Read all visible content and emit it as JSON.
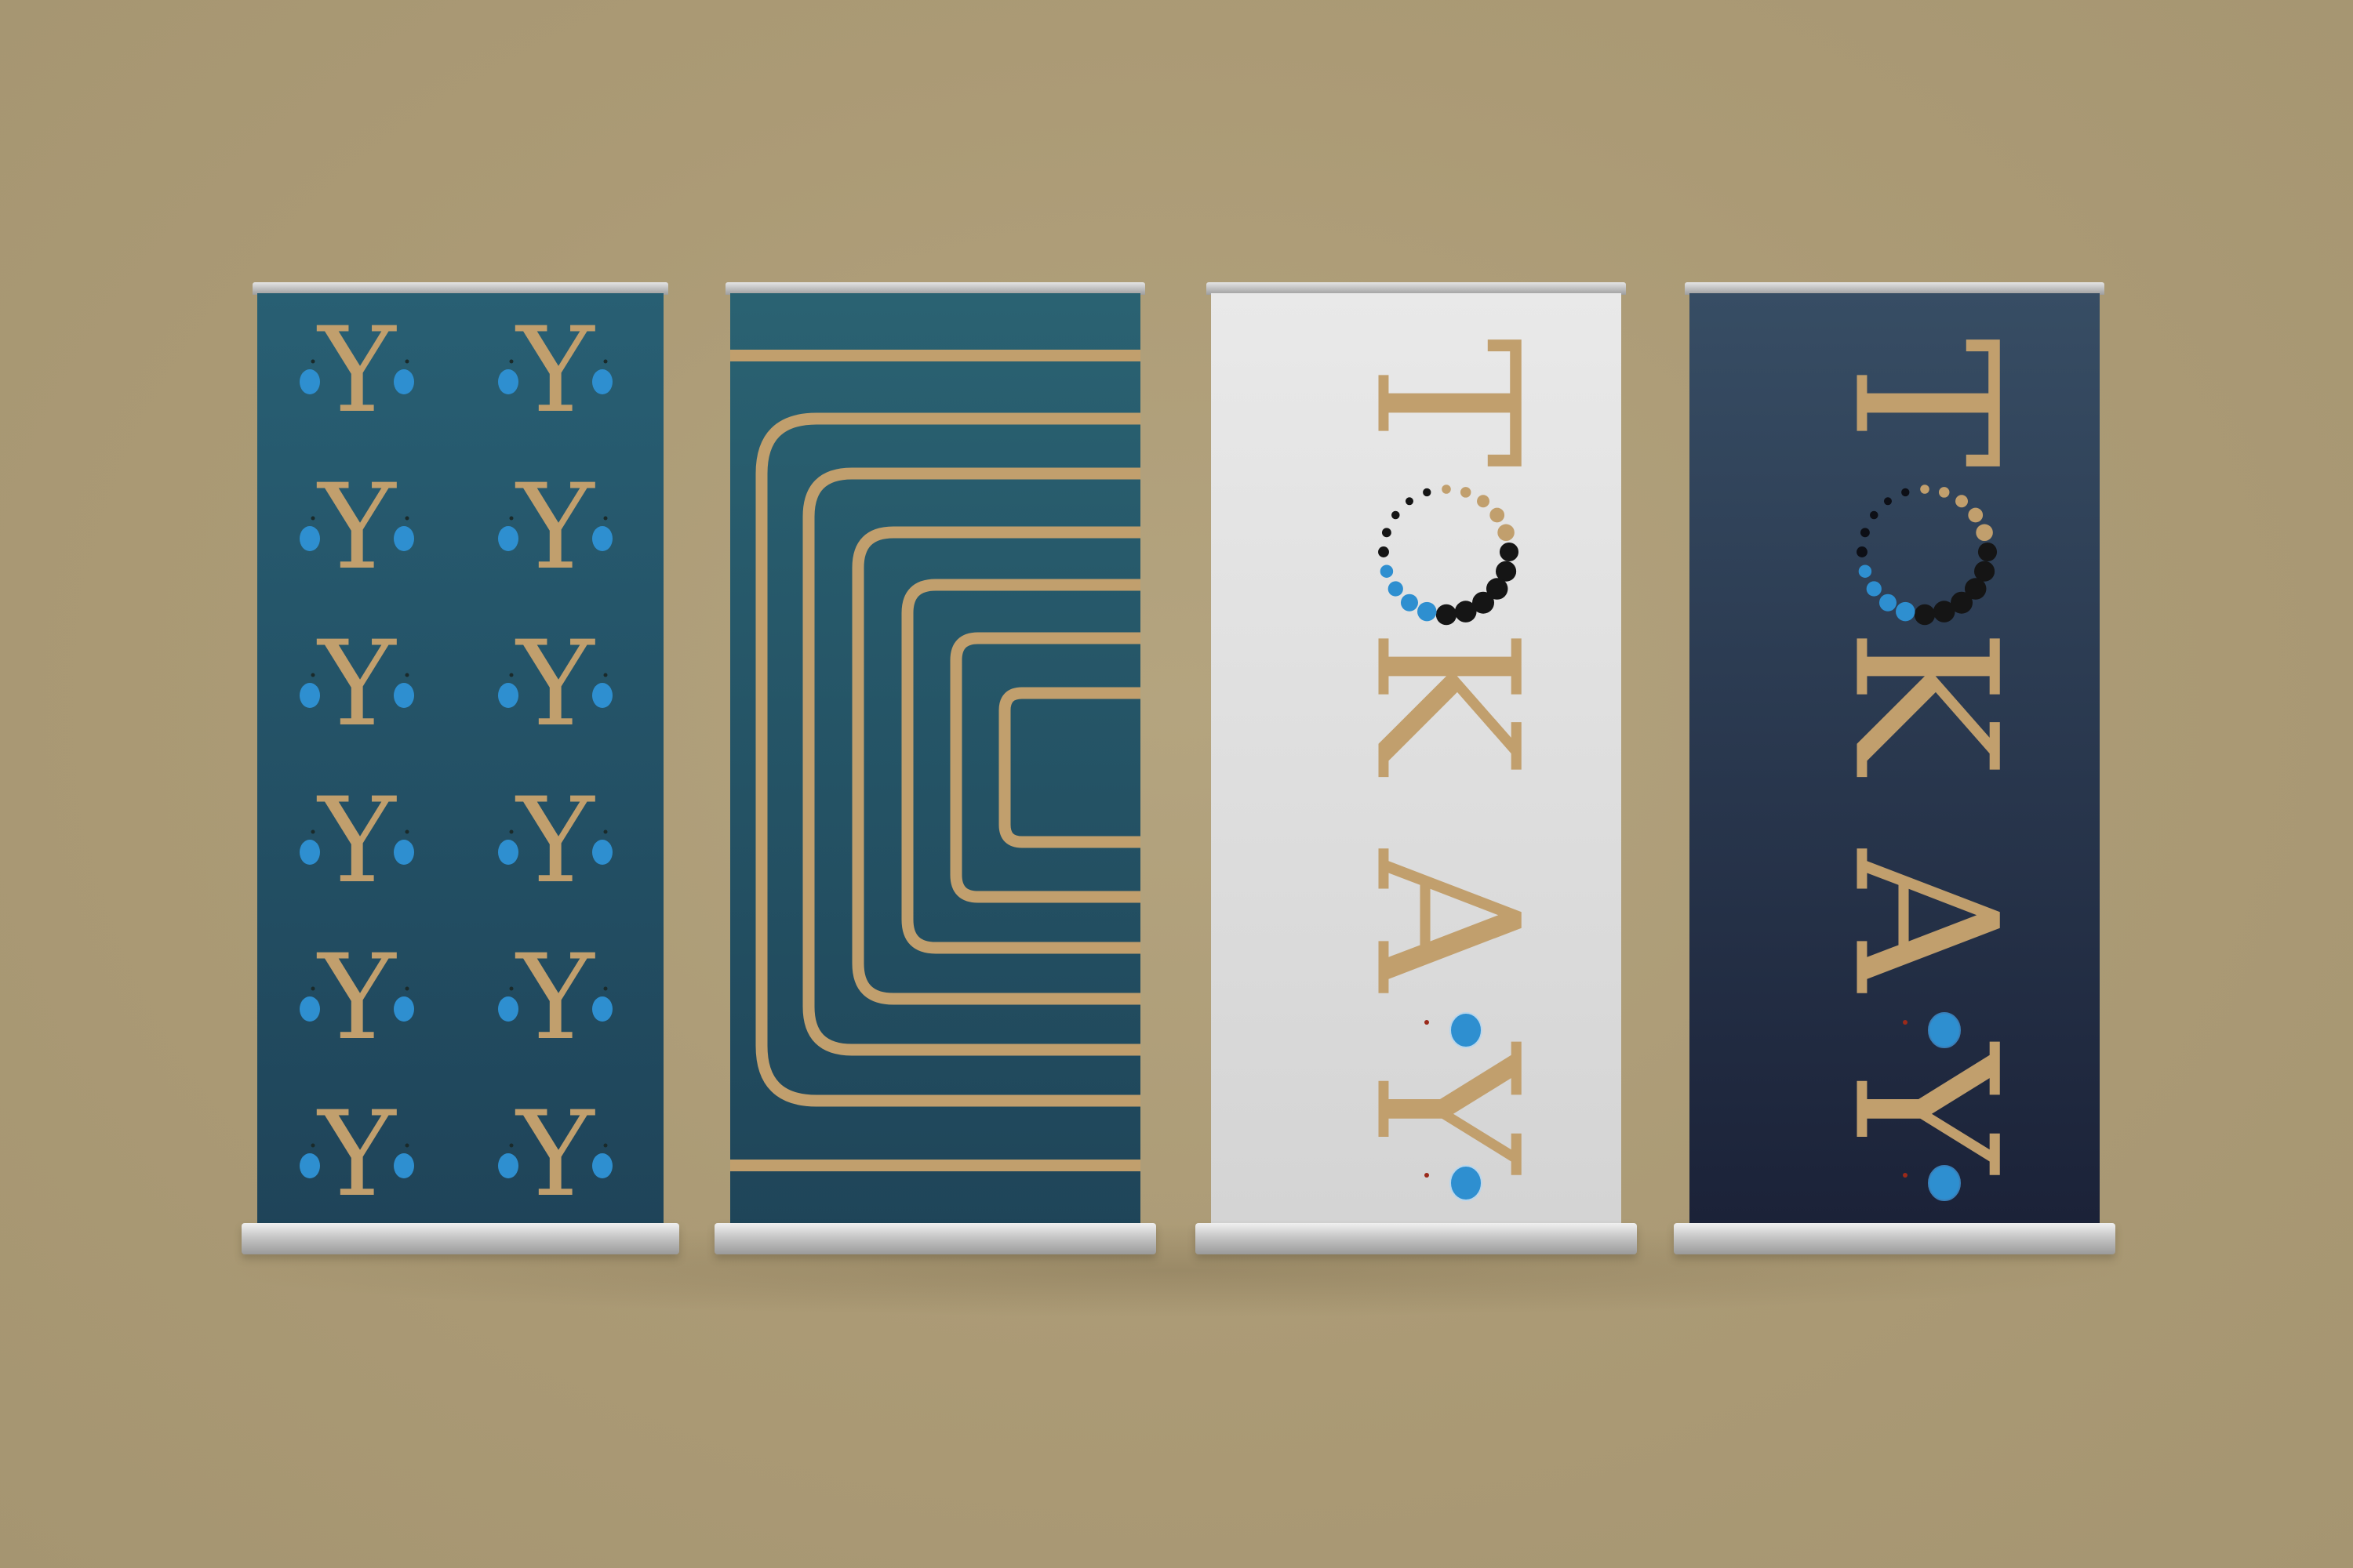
{
  "banners": [
    {
      "kind": "monogram-pattern",
      "monogram_letter": "Y",
      "rows": 6,
      "cols": 2,
      "bg_top": "#285f73",
      "bg_bottom": "#1f4459"
    },
    {
      "kind": "concentric-frames",
      "frames": 6,
      "bg_top": "#2a6272",
      "bg_bottom": "#1f4559"
    },
    {
      "kind": "wordmark",
      "wordmark": "YAKOT",
      "orientation": "vertical-rotated",
      "bg_top": "#e9e9e9",
      "bg_bottom": "#d4d4d4"
    },
    {
      "kind": "wordmark",
      "wordmark": "YAKOT",
      "orientation": "vertical-rotated",
      "bg_top": "#374d64",
      "bg_bottom": "#1b2238"
    }
  ],
  "colors": {
    "gold": "#c19f6d",
    "blue": "#2e8fd0",
    "black": "#151515",
    "stand_metal": "#c8c8c8"
  }
}
